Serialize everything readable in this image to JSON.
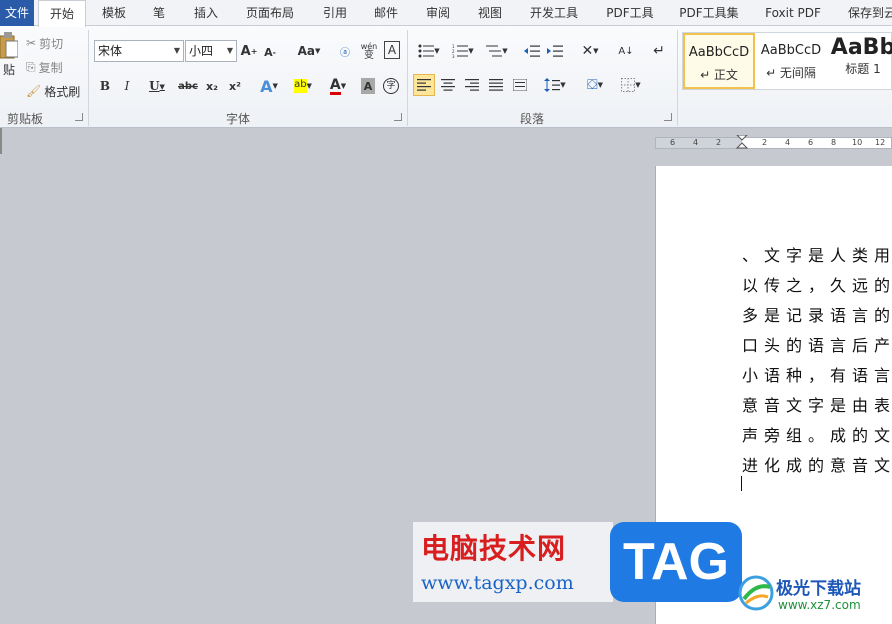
{
  "menu": {
    "file": "文件",
    "tabs": [
      "开始",
      "模板",
      "笔",
      "插入",
      "页面布局",
      "引用",
      "邮件",
      "审阅",
      "视图",
      "开发工具",
      "PDF工具",
      "PDF工具集",
      "Foxit PDF",
      "保存到云"
    ]
  },
  "clipboard": {
    "paste": "贴",
    "cut": "剪切",
    "copy": "复制",
    "format_painter": "格式刷",
    "label": "剪贴板"
  },
  "font": {
    "name": "宋体",
    "size": "小四",
    "grow": "A",
    "shrink": "A",
    "case": "Aa",
    "phonetic": "wén",
    "phonetic_char": "变",
    "border_char": "A",
    "bold": "B",
    "italic": "I",
    "underline": "U",
    "strike": "abc",
    "sub": "x₂",
    "sup": "x²",
    "highlight": "ab",
    "color_a": "A",
    "shade_a": "A",
    "encircle": "字",
    "label": "字体"
  },
  "paragraph": {
    "label": "段落"
  },
  "styles": [
    {
      "sample": "AaBbCcD",
      "name": "↵ 正文"
    },
    {
      "sample": "AaBbCcD",
      "name": "↵ 无间隔"
    },
    {
      "sample": "AaBb",
      "name": "标题 1"
    }
  ],
  "ruler": [
    "6",
    "4",
    "2",
    "2",
    "4",
    "6",
    "8",
    "10",
    "12"
  ],
  "document": {
    "lines": [
      "、文字是人类用",
      "以传之，久远的",
      "多是记录语言的",
      "口头的语言后产",
      "小语种，有语言",
      "意音文字是由表",
      "声旁组。成的文",
      "进化成的意音文"
    ]
  },
  "watermark": {
    "title": "电脑技术网",
    "url": "www.tagxp.com",
    "tag": "TAG",
    "xz_name": "极光下载站",
    "xz_url": "www.xz7.com"
  }
}
